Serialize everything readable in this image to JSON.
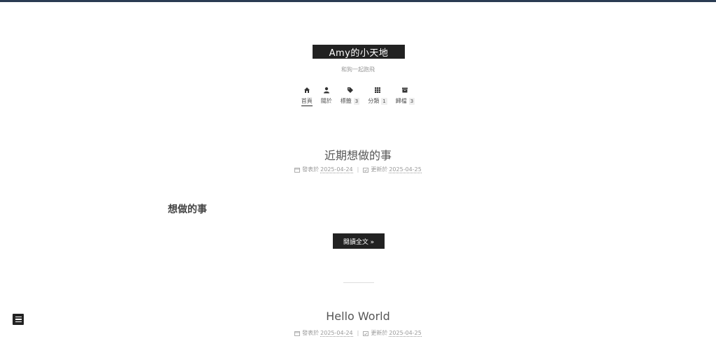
{
  "site": {
    "title": "Amy的小天地",
    "subtitle": "和狗一起跑飛"
  },
  "menu": [
    {
      "label": "首頁",
      "icon": "home-icon",
      "badge": "",
      "active": true
    },
    {
      "label": "關於",
      "icon": "user-icon",
      "badge": "",
      "active": false
    },
    {
      "label": "標籤",
      "icon": "tags-icon",
      "badge": "3",
      "active": false
    },
    {
      "label": "分類",
      "icon": "th-icon",
      "badge": "1",
      "active": false
    },
    {
      "label": "歸檔",
      "icon": "archive-icon",
      "badge": "3",
      "active": false
    }
  ],
  "posts": [
    {
      "title": "近期想做的事",
      "posted_label": "發表於",
      "posted_date": "2025-04-24",
      "updated_label": "更新於",
      "updated_date": "2025-04-25",
      "heading": "想做的事",
      "read_more": "閱讀全文 »"
    },
    {
      "title": "Hello World",
      "posted_label": "發表於",
      "posted_date": "2025-04-24",
      "updated_label": "更新於",
      "updated_date": "2025-04-25"
    }
  ],
  "meta_separator": "|",
  "colors": {
    "top_bar": "#2a3b52",
    "brand_bg": "#222222",
    "text": "#555555",
    "muted": "#999999"
  }
}
